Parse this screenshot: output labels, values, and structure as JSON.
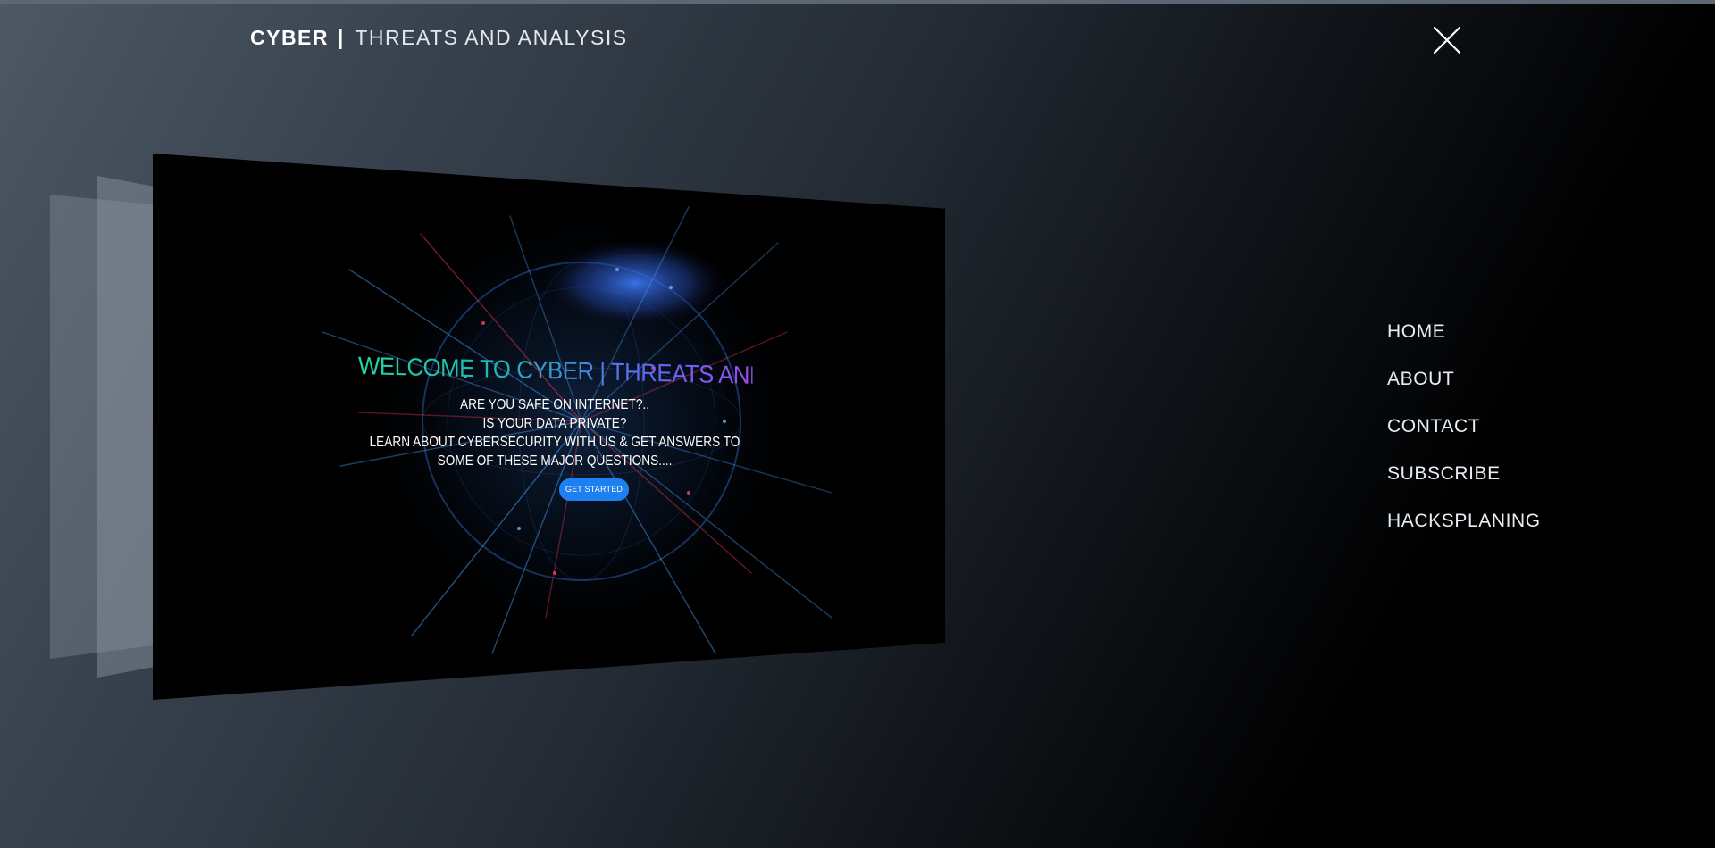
{
  "header": {
    "brand_strong": "CYBER",
    "brand_separator": "|",
    "brand_light": "THREATS AND ANALYSIS",
    "close_icon": "close-icon"
  },
  "preview": {
    "hero_title": "WELCOME TO CYBER | THREATS AND ANALYSIS",
    "line_1": "ARE YOU SAFE ON INTERNET?..",
    "line_2": "IS YOUR DATA PRIVATE?",
    "line_3": "LEARN ABOUT CYBERSECURITY WITH US & GET ANSWERS TO SOME OF THESE MAJOR QUESTIONS....",
    "cta_label": "GET STARTED",
    "background": "globe-network-image"
  },
  "nav": {
    "items": [
      {
        "label": "HOME"
      },
      {
        "label": "ABOUT"
      },
      {
        "label": "CONTACT"
      },
      {
        "label": "SUBSCRIBE"
      },
      {
        "label": "HACKSPLANING"
      }
    ]
  },
  "colors": {
    "accent_button": "#1e7ff0",
    "title_gradient_start": "#22d3a2",
    "title_gradient_end": "#9a4df0",
    "background_dark": "#000000",
    "background_light": "#4d5865"
  }
}
